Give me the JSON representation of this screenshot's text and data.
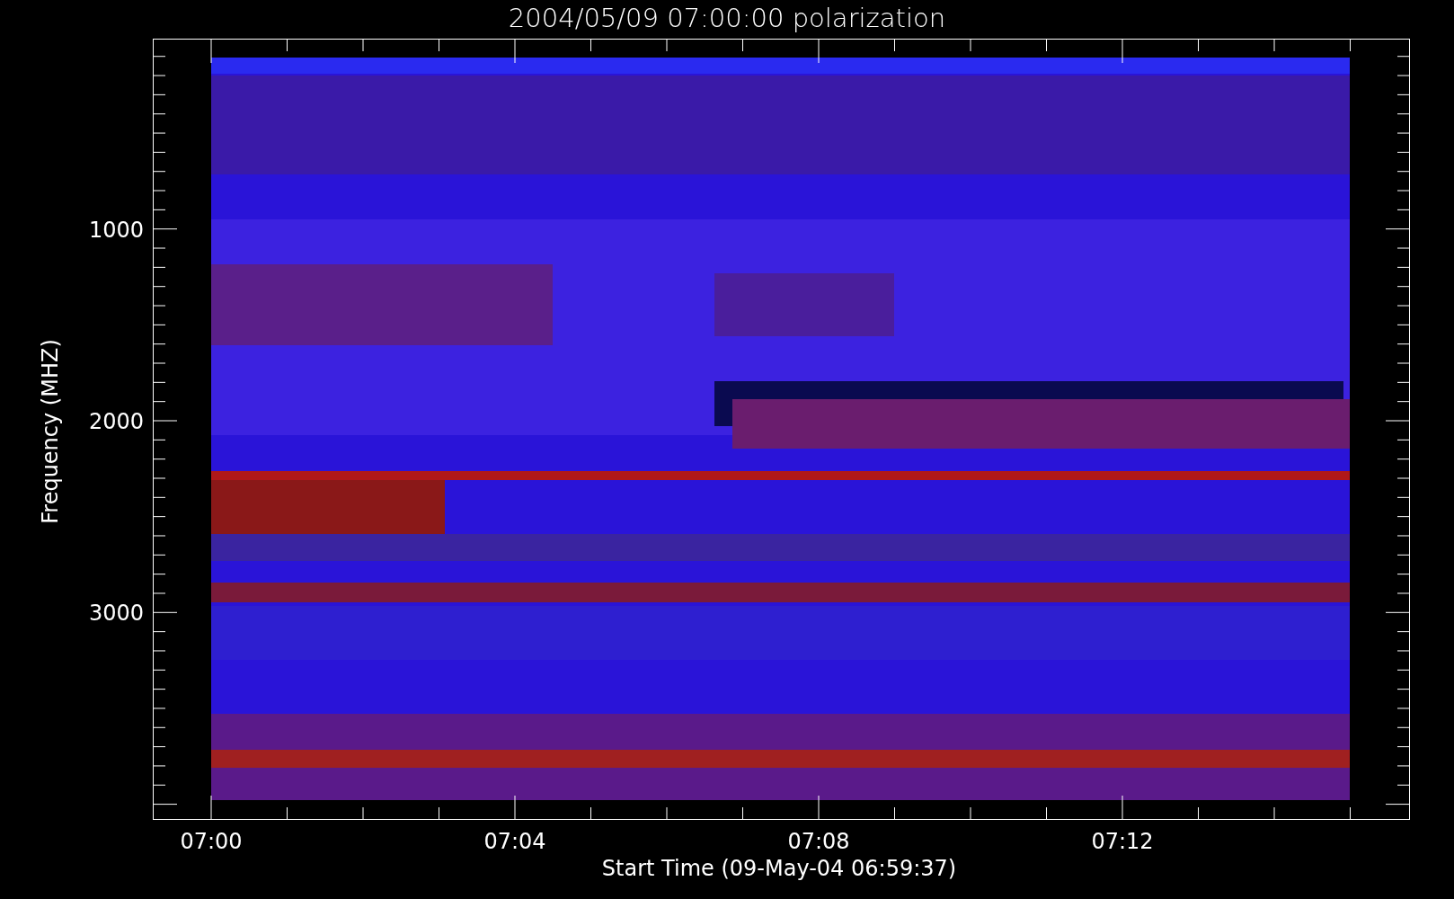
{
  "title": "2004/05/09 07:00:00 polarization",
  "plot": {
    "kind": "picture",
    "xlabel": "Start Time (09-May-04 06:59:37)",
    "ylabel": "Frequency (MHZ)",
    "xtick_labels": [
      "07:00",
      "07:04",
      "07:08",
      "07:12"
    ],
    "ytick_labels": [
      "1000",
      "2000",
      "3000"
    ]
  }
}
